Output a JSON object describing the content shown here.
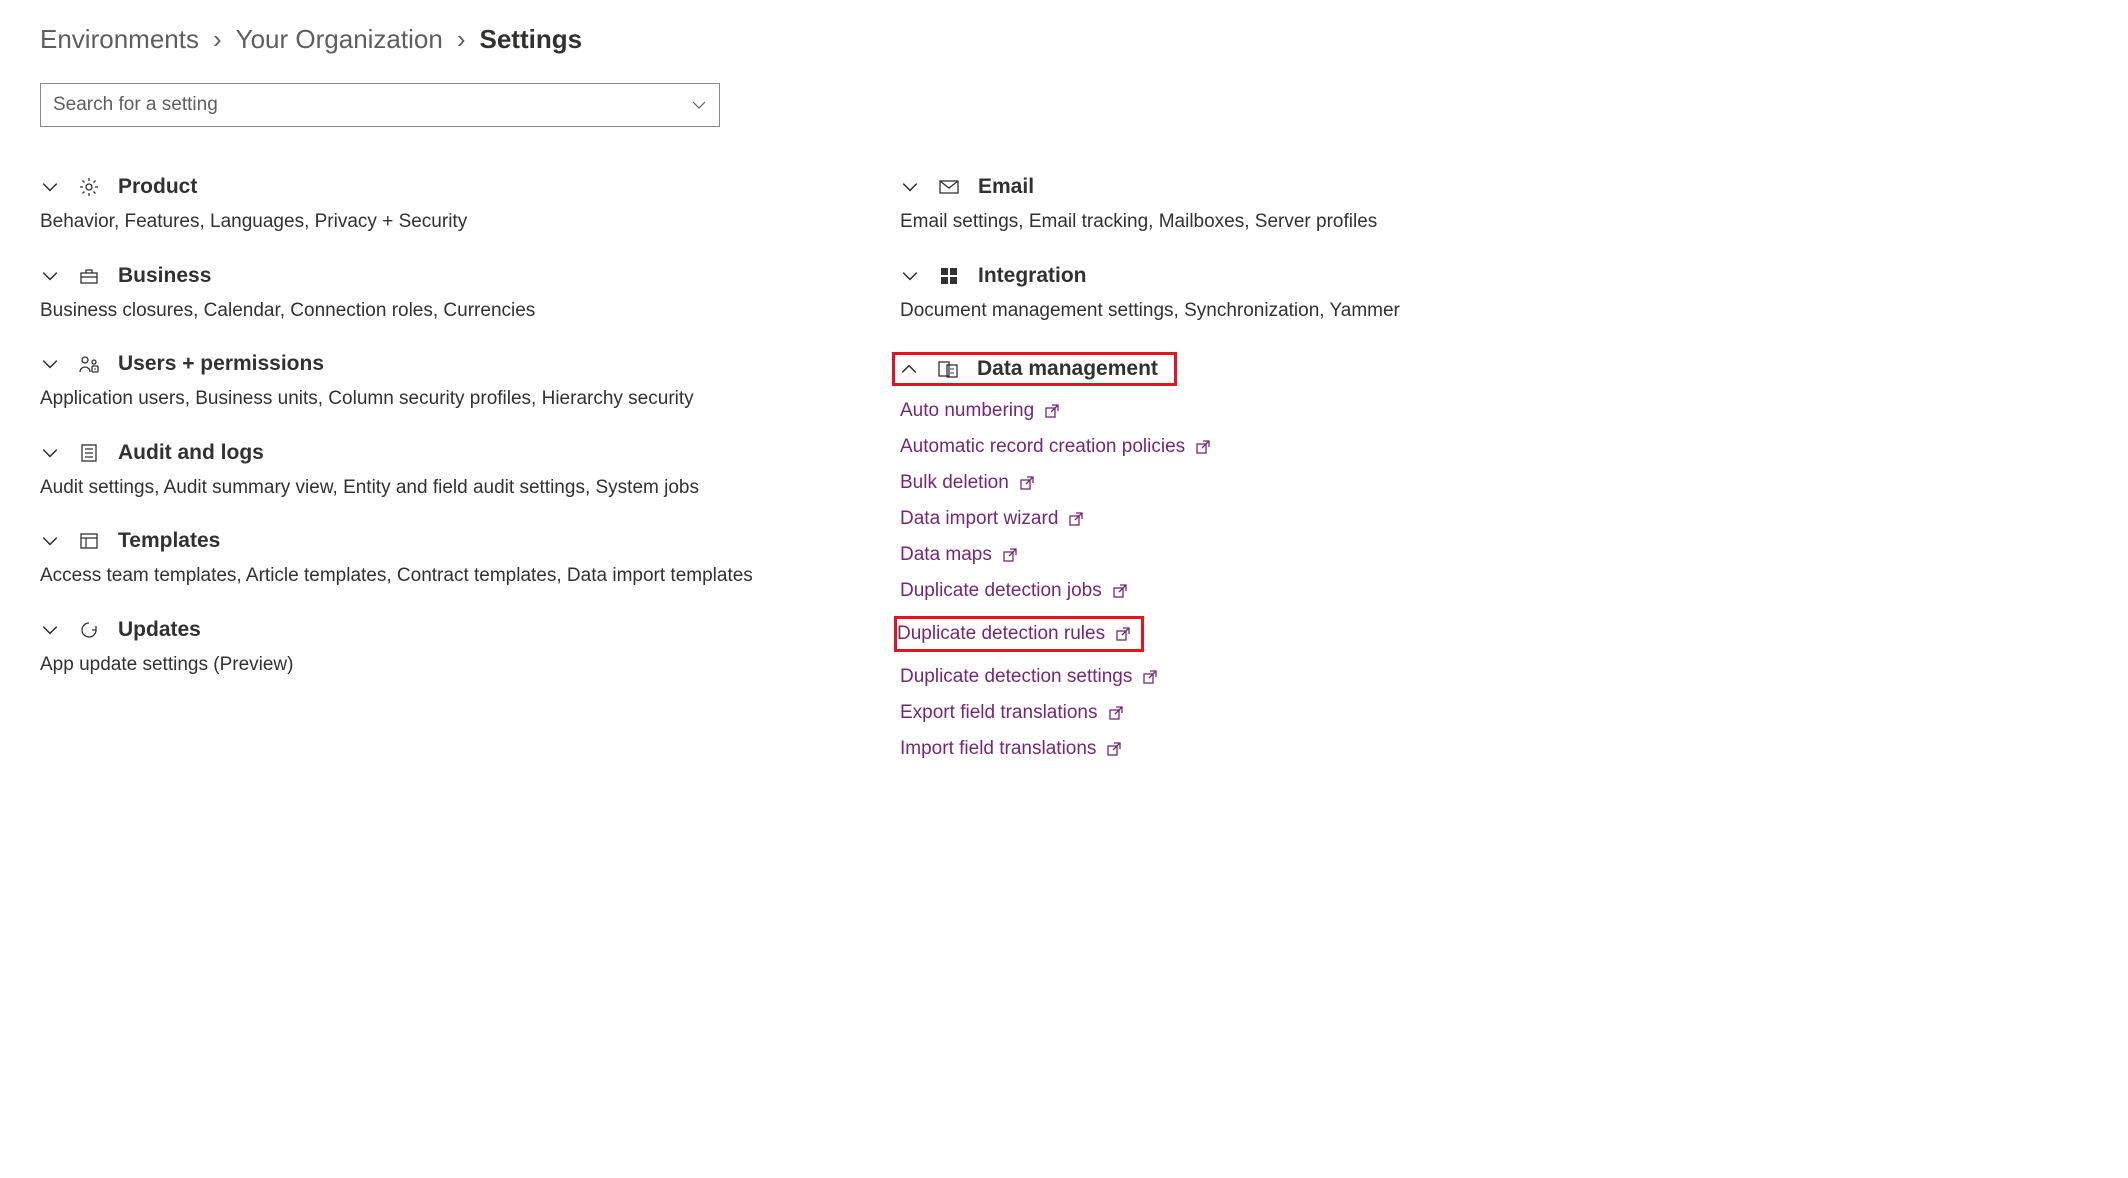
{
  "breadcrumb": {
    "items": [
      "Environments",
      "Your Organization"
    ],
    "current": "Settings"
  },
  "search": {
    "placeholder": "Search for a setting"
  },
  "left_sections": [
    {
      "title": "Product",
      "icon": "gear",
      "chevron": "down",
      "desc": "Behavior, Features, Languages, Privacy + Security"
    },
    {
      "title": "Business",
      "icon": "briefcase",
      "chevron": "down",
      "desc": "Business closures, Calendar, Connection roles, Currencies"
    },
    {
      "title": "Users + permissions",
      "icon": "users",
      "chevron": "down",
      "desc": "Application users, Business units, Column security profiles, Hierarchy security"
    },
    {
      "title": "Audit and logs",
      "icon": "list",
      "chevron": "down",
      "desc": "Audit settings, Audit summary view, Entity and field audit settings, System jobs"
    },
    {
      "title": "Templates",
      "icon": "template",
      "chevron": "down",
      "desc": "Access team templates, Article templates, Contract templates, Data import templates"
    },
    {
      "title": "Updates",
      "icon": "refresh",
      "chevron": "down",
      "desc": "App update settings (Preview)"
    }
  ],
  "right_sections": [
    {
      "title": "Email",
      "icon": "mail",
      "chevron": "down",
      "desc": "Email settings, Email tracking, Mailboxes, Server profiles",
      "expanded": false
    },
    {
      "title": "Integration",
      "icon": "windows",
      "chevron": "down",
      "desc": "Document management settings, Synchronization, Yammer",
      "expanded": false
    },
    {
      "title": "Data management",
      "icon": "data",
      "chevron": "up",
      "desc": "",
      "expanded": true,
      "highlighted": true,
      "links": [
        {
          "label": "Auto numbering"
        },
        {
          "label": "Automatic record creation policies"
        },
        {
          "label": "Bulk deletion"
        },
        {
          "label": "Data import wizard"
        },
        {
          "label": "Data maps"
        },
        {
          "label": "Duplicate detection jobs"
        },
        {
          "label": "Duplicate detection rules",
          "highlighted": true
        },
        {
          "label": "Duplicate detection settings"
        },
        {
          "label": "Export field translations"
        },
        {
          "label": "Import field translations"
        }
      ]
    }
  ]
}
